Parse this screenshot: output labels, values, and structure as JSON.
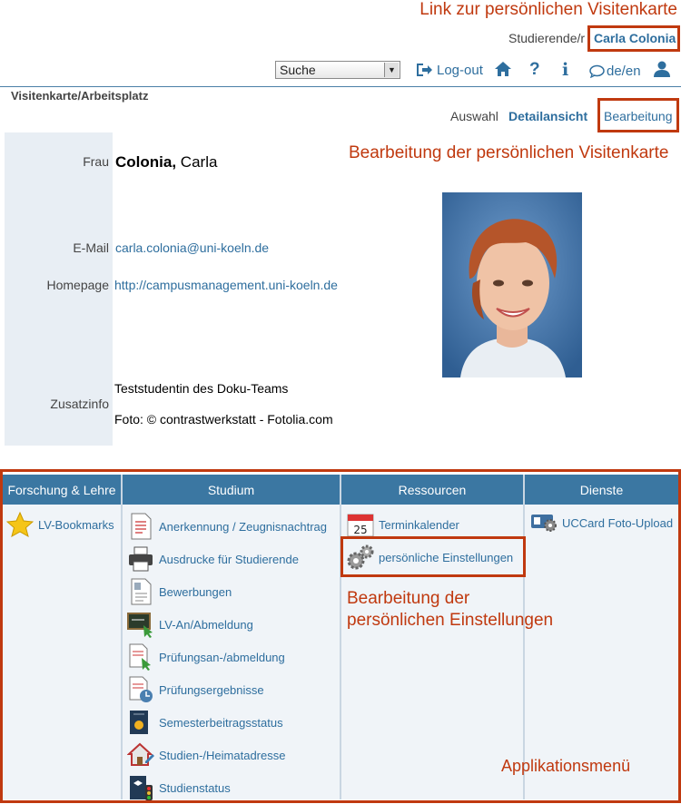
{
  "annotations": {
    "visitenkarte_link": "Link zur persönlichen Visitenkarte",
    "bearbeitung_visitenkarte": "Bearbeitung der persönlichen Visitenkarte",
    "bearbeitung_einstellungen_1": "Bearbeitung der",
    "bearbeitung_einstellungen_2": "persönlichen Einstellungen",
    "applikationsmenu": "Applikationsmenü"
  },
  "header": {
    "role": "Studierende/r",
    "user_name": "Carla Colonia",
    "search_select": "Suche",
    "logout": "Log-out",
    "lang": "de/en"
  },
  "page": {
    "title": "Visitenkarte/Arbeitsplatz",
    "tabs": [
      "Auswahl",
      "Detailansicht",
      "Bearbeitung"
    ]
  },
  "card": {
    "salutation_label": "Frau",
    "last_name": "Colonia,",
    "first_name": "Carla",
    "email_label": "E-Mail",
    "email": "carla.colonia@uni-koeln.de",
    "homepage_label": "Homepage",
    "homepage": "http://campusmanagement.uni-koeln.de",
    "info_label": "Zusatzinfo",
    "info_line1": "Teststudentin des Doku-Teams",
    "info_line2": "Foto: © contrastwerkstatt - Fotolia.com"
  },
  "menu": {
    "columns": [
      "Forschung & Lehre",
      "Studium",
      "Ressourcen",
      "Dienste"
    ],
    "forschung": [
      "LV-Bookmarks"
    ],
    "studium": [
      "Anerkennung / Zeugnisnachtrag",
      "Ausdrucke für Studierende",
      "Bewerbungen",
      "LV-An/Abmeldung",
      "Prüfungsan-/abmeldung",
      "Prüfungsergebnisse",
      "Semesterbeitragsstatus",
      "Studien-/Heimatadresse",
      "Studienstatus"
    ],
    "ressourcen": [
      "Terminkalender",
      "persönliche Einstellungen"
    ],
    "dienste": [
      "UCCard Foto-Upload"
    ],
    "calendar_day": "25"
  },
  "colors": {
    "accent": "#2e6e9e",
    "menu_header": "#3b77a2",
    "annotation": "#c0390f"
  }
}
